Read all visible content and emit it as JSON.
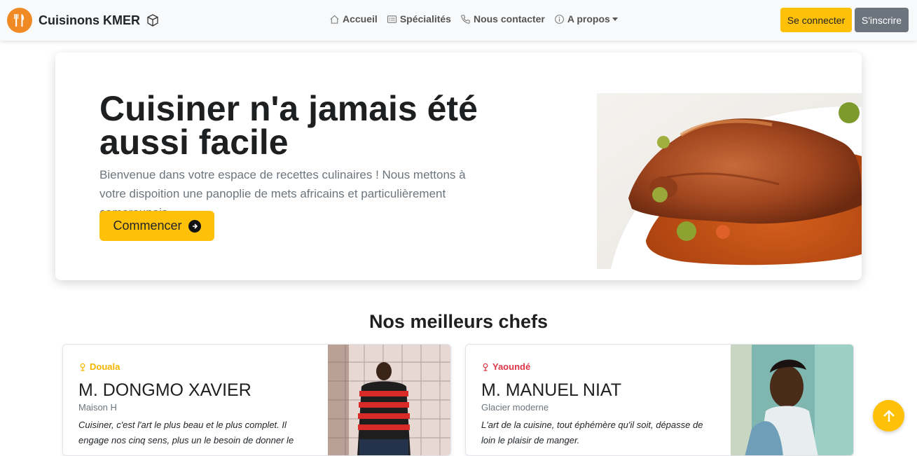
{
  "brand": {
    "title": "Cuisinons KMER",
    "logo_icon": "utensils-icon",
    "cube_icon": "cube-icon"
  },
  "nav": {
    "items": [
      {
        "label": "Accueil",
        "icon": "house-icon"
      },
      {
        "label": "Spécialités",
        "icon": "card-list-icon"
      },
      {
        "label": "Nous contacter",
        "icon": "telephone-icon"
      },
      {
        "label": "A propos",
        "icon": "info-circle-icon"
      }
    ],
    "login_label": "Se connecter",
    "signup_label": "S'inscrire"
  },
  "hero": {
    "title": "Cuisiner n'a jamais été aussi facile",
    "lead": "Bienvenue dans votre espace de recettes culinaires ! Nous mettons à votre dispoition une panoplie de mets africains et particulièrement camerounais.",
    "cta_label": "Commencer"
  },
  "chefs": {
    "title": "Nos meilleurs chefs",
    "items": [
      {
        "city": "Douala",
        "name": "M. DONGMO XAVIER",
        "shop": "Maison H",
        "quote": "Cuisiner, c'est l'art le plus beau et le plus complet. Il engage nos cinq sens, plus un le besoin de donner le",
        "city_color": "#f5b400"
      },
      {
        "city": "Yaoundé",
        "name": "M. MANUEL NIAT",
        "shop": "Glacier moderne",
        "quote": "L'art de la cuisine, tout éphémère qu'il soit, dépasse de loin le plaisir de manger.",
        "city_color": "#dc3545"
      }
    ]
  },
  "colors": {
    "accent": "#ffc107",
    "secondary": "#6c757d",
    "logo": "#f08a24"
  }
}
